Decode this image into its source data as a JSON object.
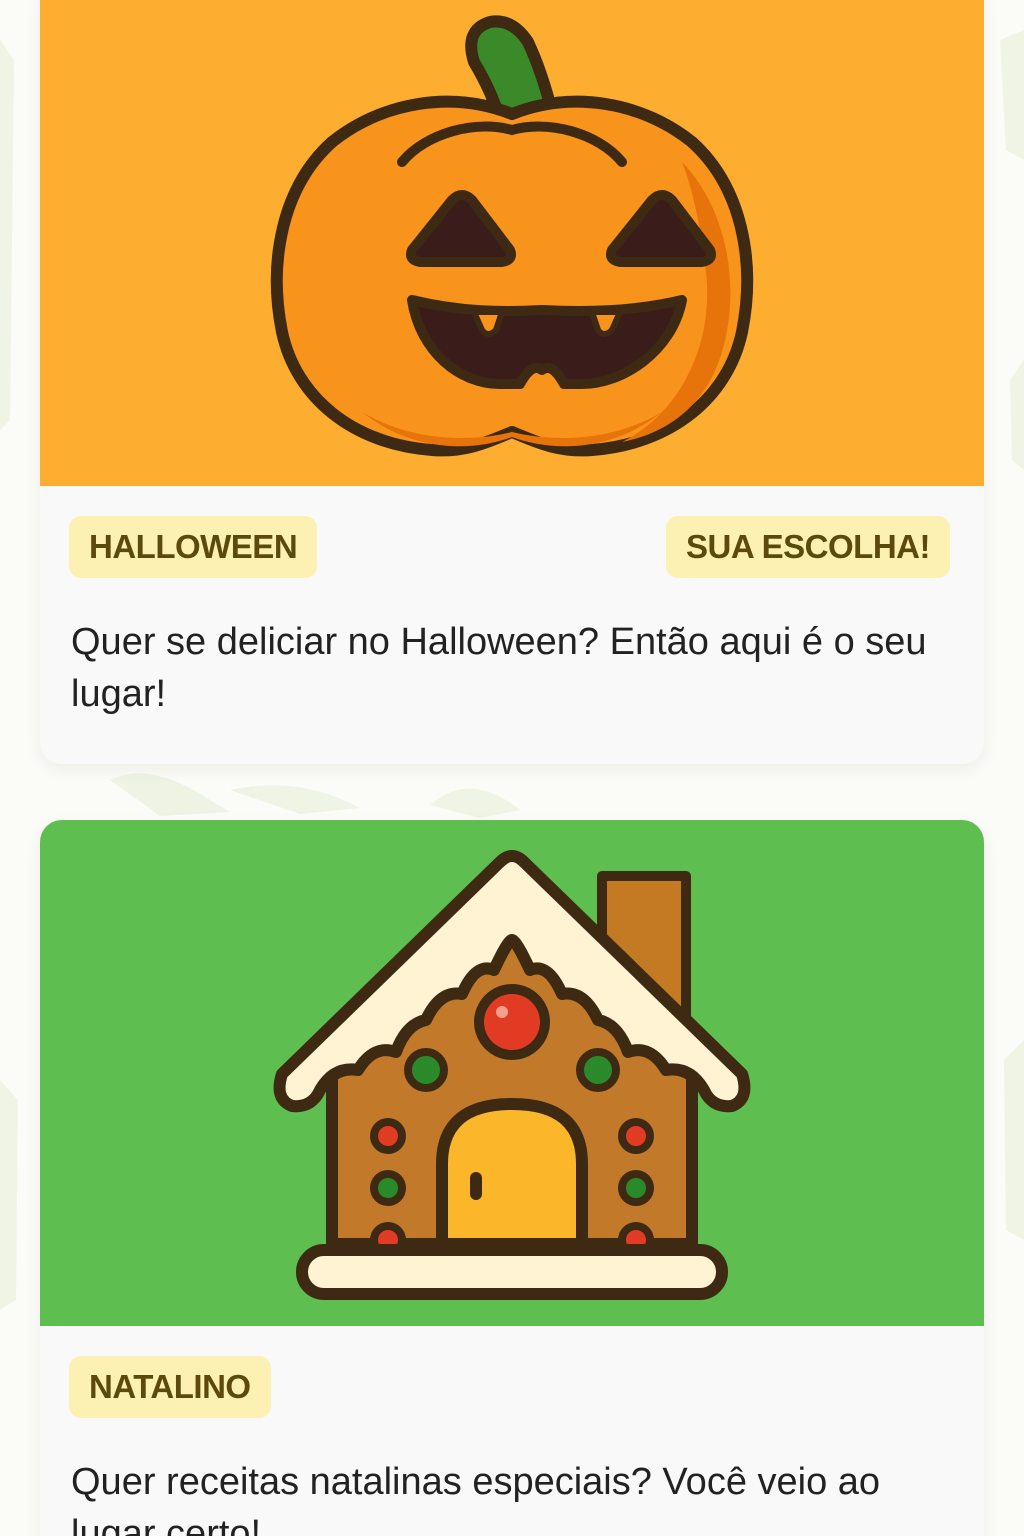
{
  "cards": [
    {
      "hero_color": "#fdad2f",
      "icon": "jack-o-lantern-icon",
      "tag": "HALLOWEEN",
      "badge": "SUA ESCOLHA!",
      "description": "Quer se deliciar no Halloween? Então aqui é o seu lugar!"
    },
    {
      "hero_color": "#5ebf50",
      "icon": "gingerbread-house-icon",
      "tag": "NATALINO",
      "description": "Quer receitas natalinas especiais? Você veio ao lugar certo!"
    }
  ],
  "colors": {
    "tag_background": "#fdf0b3",
    "tag_text": "#5b4a0c",
    "outline": "#4a2e10"
  }
}
